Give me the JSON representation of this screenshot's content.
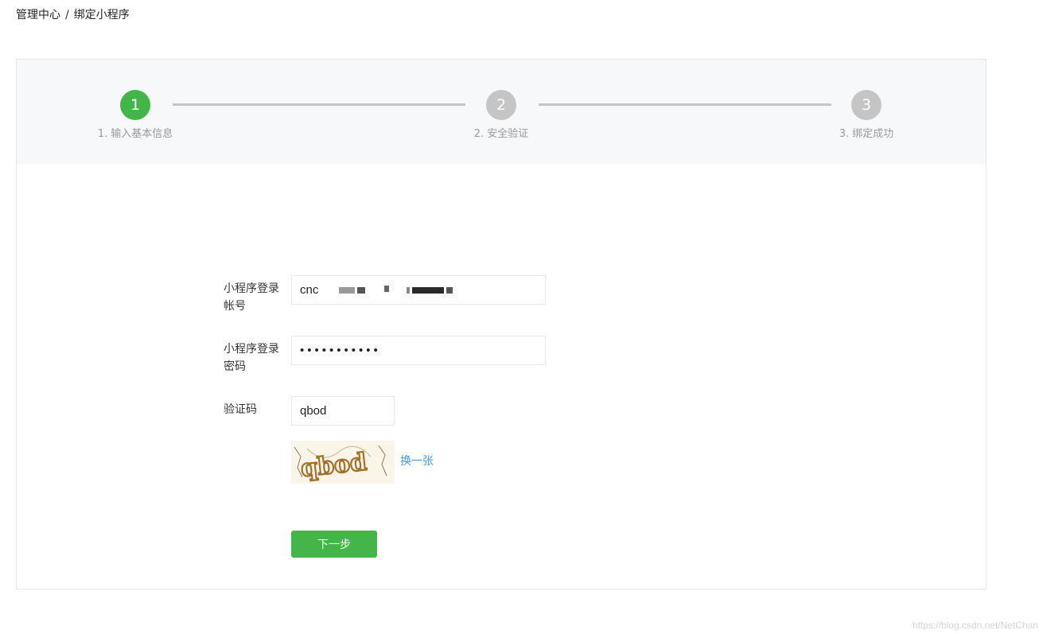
{
  "breadcrumb": {
    "root": "管理中心",
    "separator": "/",
    "current": "绑定小程序"
  },
  "steps": [
    {
      "number": "1",
      "label": "1. 输入基本信息",
      "state": "active"
    },
    {
      "number": "2",
      "label": "2. 安全验证",
      "state": "pending"
    },
    {
      "number": "3",
      "label": "3. 绑定成功",
      "state": "pending"
    }
  ],
  "form": {
    "account": {
      "label_line1": "小程序登录",
      "label_line2": "帐号",
      "value": "cnc"
    },
    "password": {
      "label_line1": "小程序登录",
      "label_line2": "密码",
      "value": "●●●●●●●●●●●"
    },
    "captcha": {
      "label": "验证码",
      "value": "qbod",
      "image_text": "qbod",
      "refresh_label": "换一张"
    },
    "next_label": "下一步"
  },
  "colors": {
    "accent": "#44b549",
    "step_inactive": "#c5c5c5",
    "link": "#459ae9"
  },
  "watermark": "https://blog.csdn.net/NetChan"
}
